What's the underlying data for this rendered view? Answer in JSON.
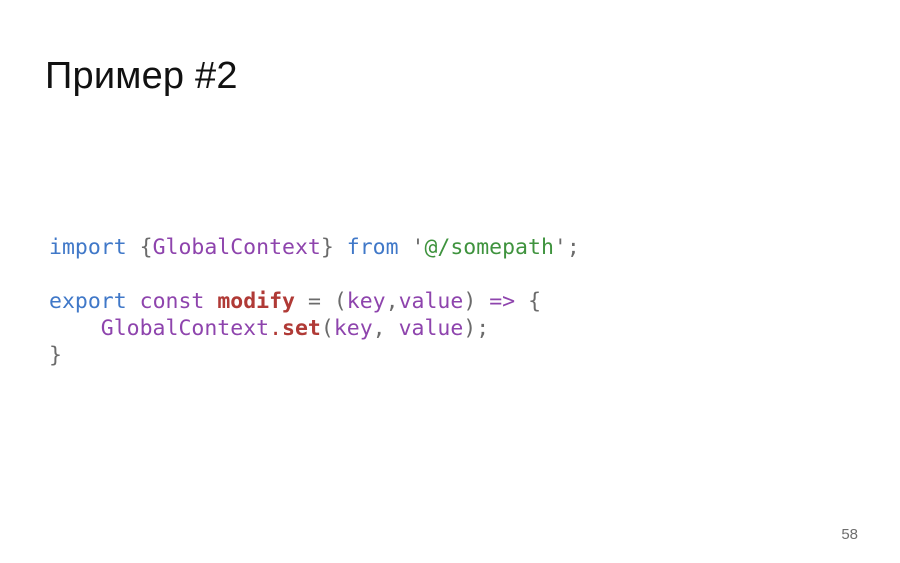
{
  "slide": {
    "title": "Пример #2",
    "page_number": "58",
    "background_color": "#ffffff"
  },
  "colors": {
    "title_text": "#111111",
    "keyword_blue": "#4078c8",
    "keyword_purple": "#8e44ad",
    "identifier_purple": "#8e44ad",
    "function_red": "#b03a36",
    "punctuation_gray": "#6b6b6b",
    "string_green": "#3f933e",
    "page_number_gray": "#6e6e6e"
  },
  "code": {
    "language": "javascript",
    "lines": [
      {
        "index": 0,
        "text": "import {GlobalContext} from '@/somepath';",
        "tokens": [
          {
            "text": "import",
            "kind": "keyword-blue"
          },
          {
            "text": " ",
            "kind": "plain"
          },
          {
            "text": "{",
            "kind": "punct"
          },
          {
            "text": "GlobalContext",
            "kind": "identifier"
          },
          {
            "text": "}",
            "kind": "punct"
          },
          {
            "text": " ",
            "kind": "plain"
          },
          {
            "text": "from",
            "kind": "keyword-blue"
          },
          {
            "text": " ",
            "kind": "plain"
          },
          {
            "text": "'",
            "kind": "punct"
          },
          {
            "text": "@/somepath",
            "kind": "string"
          },
          {
            "text": "'",
            "kind": "punct"
          },
          {
            "text": ";",
            "kind": "punct"
          }
        ]
      },
      {
        "index": 1,
        "text": "",
        "tokens": []
      },
      {
        "index": 2,
        "text": "export const modify = (key,value) => {",
        "tokens": [
          {
            "text": "export",
            "kind": "keyword-blue"
          },
          {
            "text": " ",
            "kind": "plain"
          },
          {
            "text": "const",
            "kind": "keyword-purple"
          },
          {
            "text": " ",
            "kind": "plain"
          },
          {
            "text": "modify",
            "kind": "function"
          },
          {
            "text": " ",
            "kind": "plain"
          },
          {
            "text": "=",
            "kind": "punct"
          },
          {
            "text": " ",
            "kind": "plain"
          },
          {
            "text": "(",
            "kind": "punct"
          },
          {
            "text": "key",
            "kind": "identifier"
          },
          {
            "text": ",",
            "kind": "punct"
          },
          {
            "text": "value",
            "kind": "identifier"
          },
          {
            "text": ")",
            "kind": "punct"
          },
          {
            "text": " ",
            "kind": "plain"
          },
          {
            "text": "=>",
            "kind": "arrow"
          },
          {
            "text": " ",
            "kind": "plain"
          },
          {
            "text": "{",
            "kind": "punct"
          }
        ]
      },
      {
        "index": 3,
        "text": "    GlobalContext.set(key, value);",
        "tokens": [
          {
            "text": "    ",
            "kind": "plain"
          },
          {
            "text": "GlobalContext",
            "kind": "identifier"
          },
          {
            "text": ".",
            "kind": "dot"
          },
          {
            "text": "set",
            "kind": "function"
          },
          {
            "text": "(",
            "kind": "punct"
          },
          {
            "text": "key",
            "kind": "identifier"
          },
          {
            "text": ",",
            "kind": "punct"
          },
          {
            "text": " ",
            "kind": "plain"
          },
          {
            "text": "value",
            "kind": "identifier"
          },
          {
            "text": ")",
            "kind": "punct"
          },
          {
            "text": ";",
            "kind": "punct"
          }
        ]
      },
      {
        "index": 4,
        "text": "}",
        "tokens": [
          {
            "text": "}",
            "kind": "punct"
          }
        ]
      }
    ]
  }
}
